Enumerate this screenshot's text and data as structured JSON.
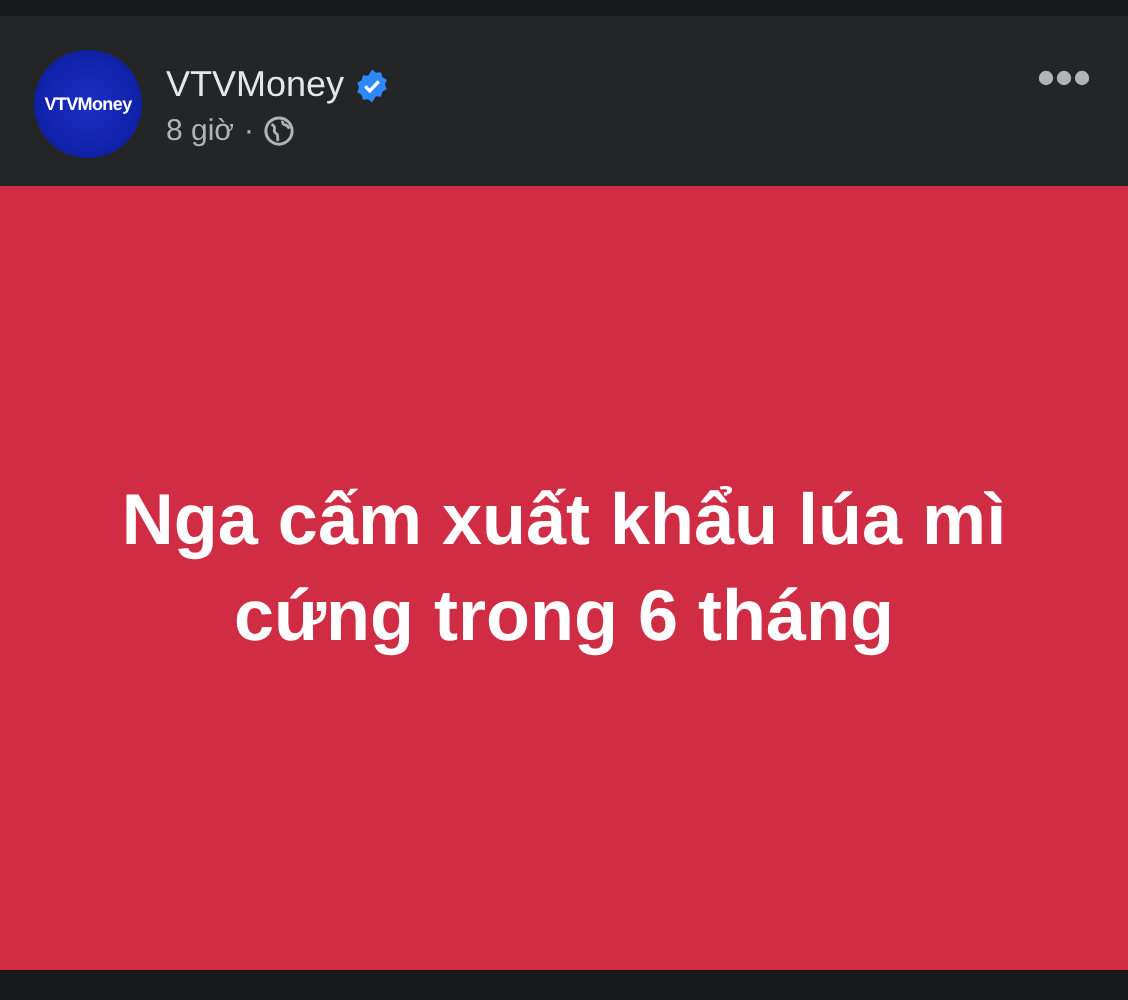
{
  "post": {
    "author": {
      "name": "VTVMoney",
      "verified": true,
      "avatar_text": "VTVMoney"
    },
    "time": "8 giờ",
    "separator": "·",
    "public": true
  },
  "card": {
    "headline_lines": [
      "Nga cấm xuất khẩu lúa mì",
      "cứng trong 6 tháng"
    ]
  }
}
